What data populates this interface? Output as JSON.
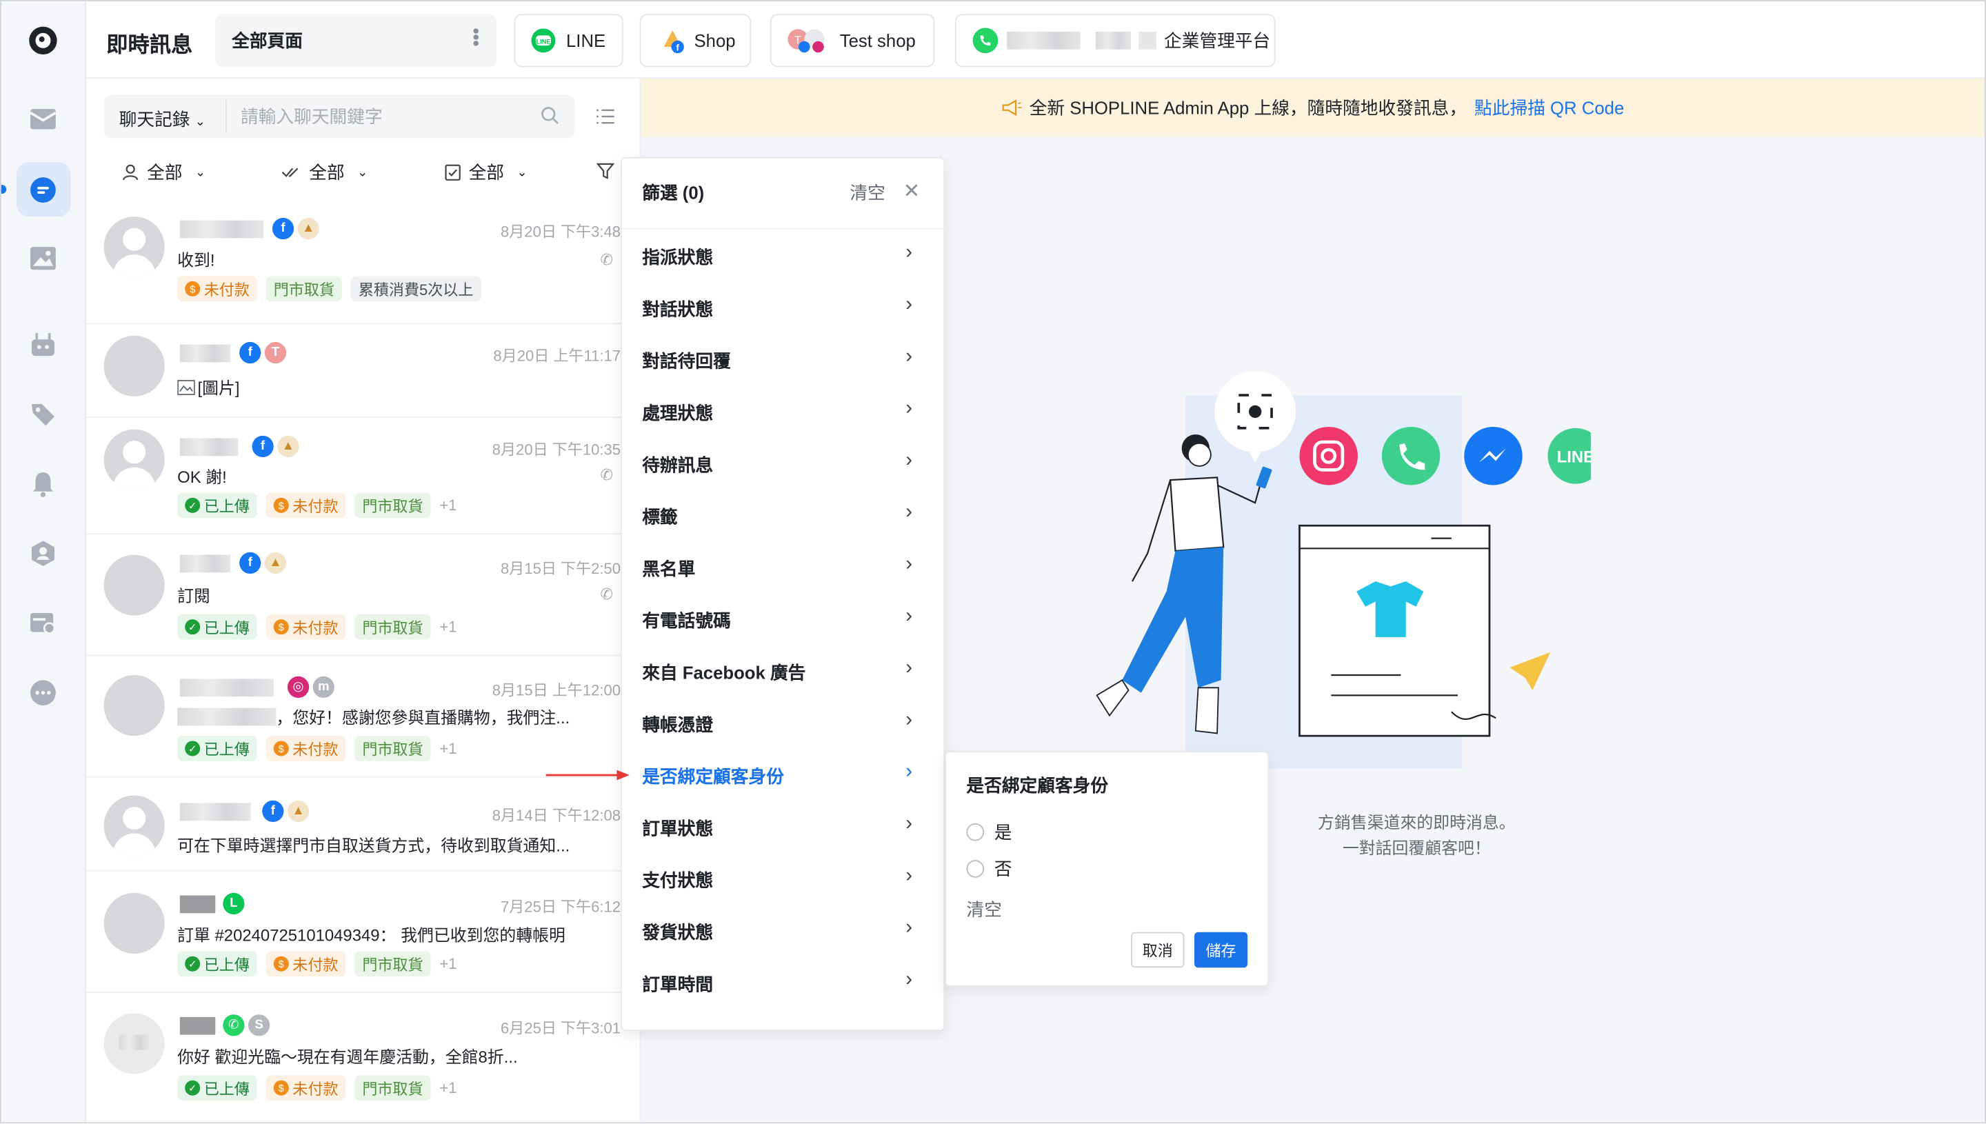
{
  "app": {
    "title": "即時訊息"
  },
  "tabs": [
    {
      "label": "全部頁面"
    },
    {
      "label": "LINE"
    },
    {
      "label": "Shop"
    },
    {
      "label": "Test shop"
    },
    {
      "label": "企業管理平台"
    }
  ],
  "search": {
    "mode": "聊天記錄",
    "placeholder": "請輸入聊天關鍵字"
  },
  "filters": {
    "assignee": "全部",
    "read": "全部",
    "status": "全部"
  },
  "conversations": [
    {
      "time": "8月20日 下午3:48",
      "message": "收到!",
      "tags": [
        "未付款",
        "門市取貨",
        "累積消費5次以上"
      ]
    },
    {
      "time": "8月20日 上午11:17",
      "message": "[圖片]",
      "tags": []
    },
    {
      "time": "8月20日 下午10:35",
      "message": "OK 謝!",
      "tags": [
        "已上傳",
        "未付款",
        "門市取貨"
      ],
      "more": "+1"
    },
    {
      "time": "8月15日 下午2:50",
      "message": "訂閱",
      "tags": [
        "已上傳",
        "未付款",
        "門市取貨"
      ],
      "more": "+1"
    },
    {
      "time": "8月15日 上午12:00",
      "message": "，您好！感謝您參與直播購物，我們注...",
      "tags": [
        "已上傳",
        "未付款",
        "門市取貨"
      ],
      "more": "+1"
    },
    {
      "time": "8月14日 下午12:08",
      "message": "可在下單時選擇門市自取送貨方式，待收到取貨通知...",
      "tags": []
    },
    {
      "time": "7月25日 下午6:12",
      "message": "訂單 #20240725101049349： 我們已收到您的轉帳明",
      "tags": [
        "已上傳",
        "未付款",
        "門市取貨"
      ],
      "more": "+1"
    },
    {
      "time": "6月25日 下午3:01",
      "message": "你好 歡迎光臨～現在有週年慶活動，全館8折...",
      "tags": [
        "已上傳",
        "未付款",
        "門市取貨"
      ],
      "more": "+1"
    }
  ],
  "banner": {
    "text": "全新 SHOPLINE Admin App 上線，隨時隨地收發訊息，",
    "link": "點此掃描 QR Code"
  },
  "empty_state": {
    "line1": "方銷售渠道來的即時消息。",
    "line2": "一對話回覆顧客吧！"
  },
  "filter_menu": {
    "title": "篩選 (0)",
    "clear": "清空",
    "items": [
      "指派狀態",
      "對話狀態",
      "對話待回覆",
      "處理狀態",
      "待辦訊息",
      "標籤",
      "黑名單",
      "有電話號碼",
      "來自 Facebook 廣告",
      "轉帳憑證",
      "是否綁定顧客身份",
      "訂單狀態",
      "支付狀態",
      "發貨狀態",
      "訂單時間"
    ]
  },
  "submenu": {
    "title": "是否綁定顧客身份",
    "options": [
      "是",
      "否"
    ],
    "clear": "清空",
    "cancel": "取消",
    "save": "儲存"
  },
  "colors": {
    "accent": "#1a73e8",
    "banner_bg": "#fdf2dd",
    "line_green": "#06c755",
    "fb_blue": "#1877f2",
    "annotation_red": "#e53935"
  }
}
